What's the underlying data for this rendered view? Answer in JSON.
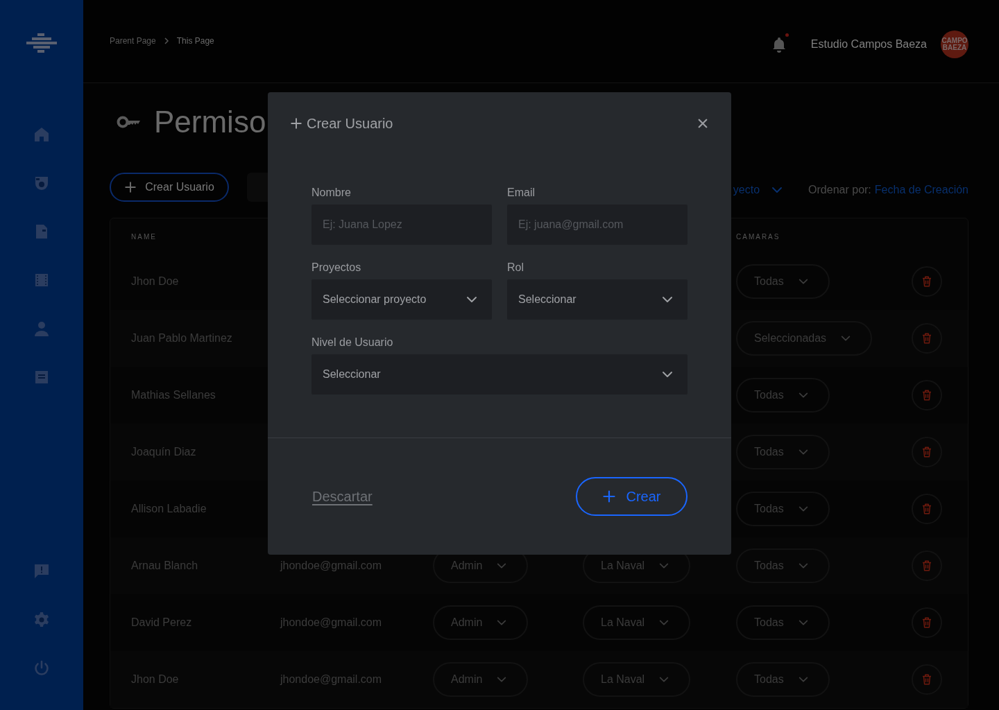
{
  "breadcrumb": [
    {
      "label": "Parent Page",
      "current": false
    },
    {
      "label": "This Page",
      "current": true
    }
  ],
  "header": {
    "unread_notifications": true,
    "account_name": "Estudio Campos Baeza",
    "avatar_text": "CAMPO BAEZA"
  },
  "page": {
    "title": "Permiso",
    "create_button": "Crear Usuario",
    "project_filter": "yecto",
    "sort_label": "Ordenar por:",
    "sort_value": "Fecha de Creación"
  },
  "table": {
    "columns": {
      "name": "NAME",
      "cameras": "CAMARAS"
    },
    "rows": [
      {
        "name": "Jhon Doe",
        "cameras": "Todas"
      },
      {
        "name": "Juan Pablo Martinez",
        "cameras": "Seleccionadas"
      },
      {
        "name": "Mathias Sellanes",
        "cameras": "Todas"
      },
      {
        "name": "Joaquín Diaz",
        "cameras": "Todas"
      },
      {
        "name": "Allison Labadie",
        "cameras": "Todas"
      },
      {
        "name": "Arnau Blanch",
        "email": "jhondoe@gmail.com",
        "role": "Admin",
        "project": "La Naval",
        "cameras": "Todas"
      },
      {
        "name": "David Perez",
        "email": "jhondoe@gmail.com",
        "role": "Admin",
        "project": "La Naval",
        "cameras": "Todas"
      },
      {
        "name": "Jhon Doe",
        "email": "jhondoe@gmail.com",
        "role": "Admin",
        "project": "La Naval",
        "cameras": "Todas"
      }
    ]
  },
  "modal": {
    "title": "Crear Usuario",
    "fields": [
      {
        "kind": "input",
        "label": "Nombre",
        "placeholder": "Ej: Juana Lopez",
        "wide": false
      },
      {
        "kind": "input",
        "label": "Email",
        "placeholder": "Ej: juana@gmail.com",
        "wide": false
      },
      {
        "kind": "select",
        "label": "Proyectos",
        "value": "Seleccionar proyecto",
        "wide": false
      },
      {
        "kind": "select",
        "label": "Rol",
        "value": "Seleccionar",
        "wide": false
      },
      {
        "kind": "select",
        "label": "Nivel de Usuario",
        "value": "Seleccionar",
        "wide": true
      }
    ],
    "discard": "Descartar",
    "submit": "Crear"
  }
}
